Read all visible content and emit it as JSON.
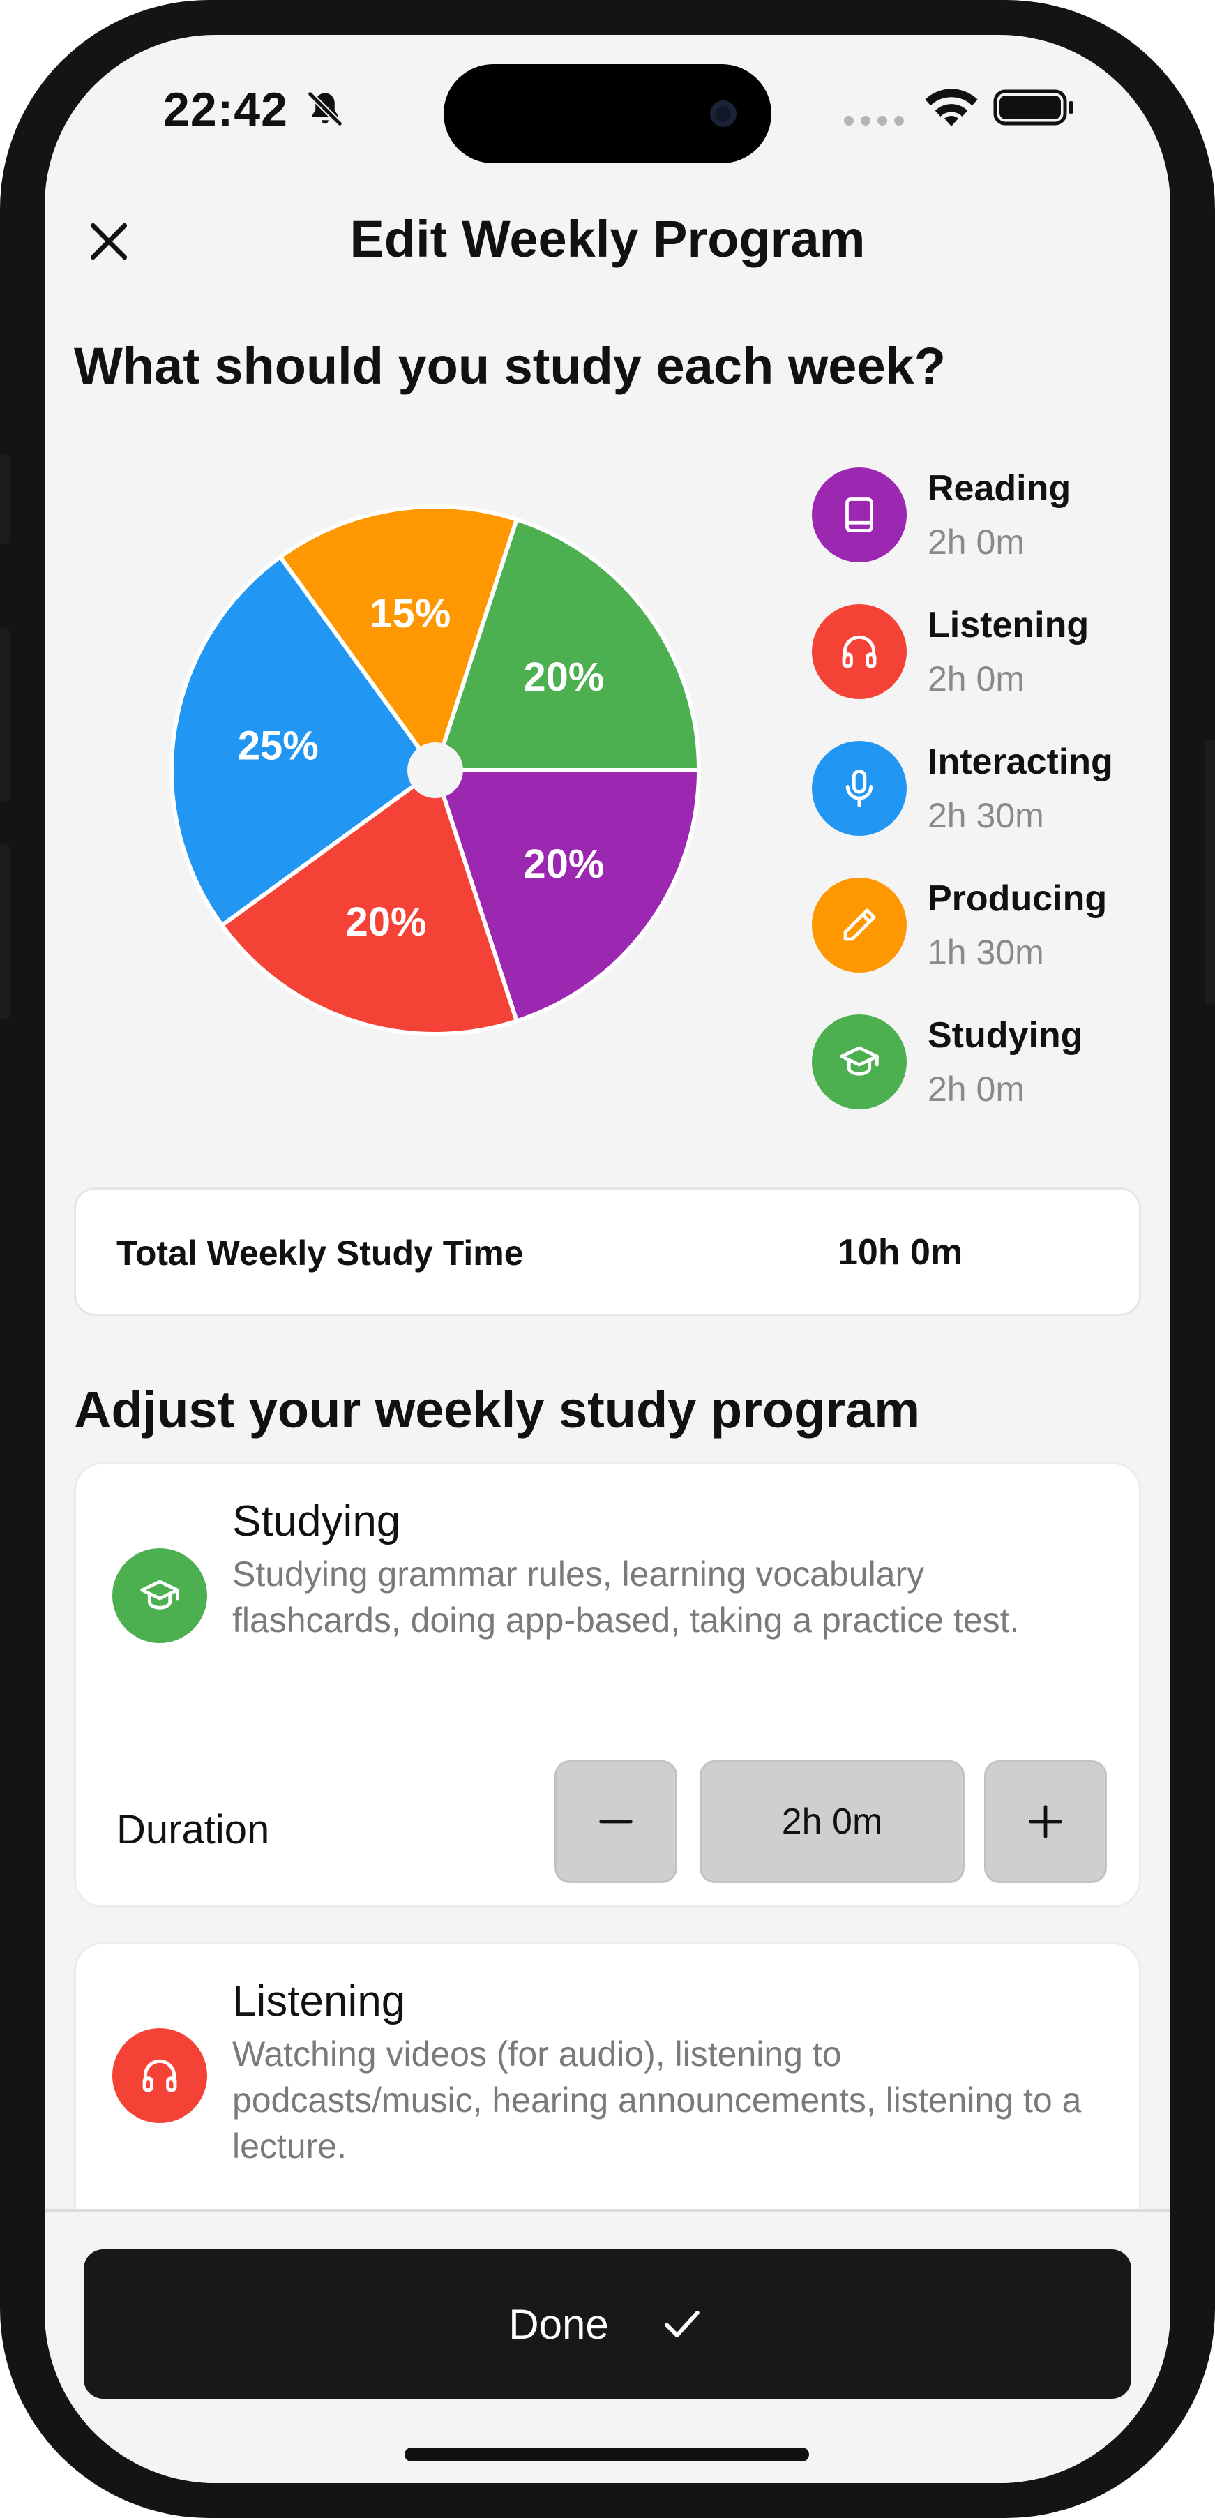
{
  "status_bar": {
    "time": "22:42",
    "icons": [
      "bell-off-icon",
      "cellular-dots-icon",
      "wifi-icon",
      "battery-icon"
    ]
  },
  "header": {
    "title": "Edit Weekly Program",
    "close_icon": "close-icon"
  },
  "overview": {
    "title": "What should you study each week?"
  },
  "chart_data": {
    "type": "pie",
    "categories": [
      "Reading",
      "Listening",
      "Interacting",
      "Producing",
      "Studying"
    ],
    "values": [
      20,
      20,
      25,
      15,
      20
    ],
    "labels": [
      "20%",
      "20%",
      "25%",
      "15%",
      "20%"
    ],
    "colors": [
      "#9c27b0",
      "#f44336",
      "#2196f3",
      "#ff9800",
      "#4caf50"
    ],
    "legend_placement": "right"
  },
  "legend": [
    {
      "name": "Reading",
      "time": "2h 0m",
      "color": "#9c27b0",
      "icon": "book-icon"
    },
    {
      "name": "Listening",
      "time": "2h 0m",
      "color": "#f44336",
      "icon": "headphones-icon"
    },
    {
      "name": "Interacting",
      "time": "2h 30m",
      "color": "#2196f3",
      "icon": "microphone-icon"
    },
    {
      "name": "Producing",
      "time": "1h 30m",
      "color": "#ff9800",
      "icon": "pencil-icon"
    },
    {
      "name": "Studying",
      "time": "2h 0m",
      "color": "#4caf50",
      "icon": "graduation-cap-icon"
    }
  ],
  "total": {
    "label": "Total Weekly Study Time",
    "value": "10h 0m"
  },
  "adjust": {
    "title": "Adjust your weekly study program",
    "cards": [
      {
        "name": "Studying",
        "description": "Studying grammar rules, learning vocabulary flashcards, doing app-based, taking a practice test.",
        "color": "#4caf50",
        "icon": "graduation-cap-icon",
        "duration_label": "Duration",
        "duration": "2h 0m"
      },
      {
        "name": "Listening",
        "description": "Watching videos (for audio), listening to podcasts/music, hearing announcements, listening to a lecture.",
        "color": "#f44336",
        "icon": "headphones-icon"
      }
    ]
  },
  "footer": {
    "done_label": "Done",
    "done_icon": "checkmark-icon"
  }
}
